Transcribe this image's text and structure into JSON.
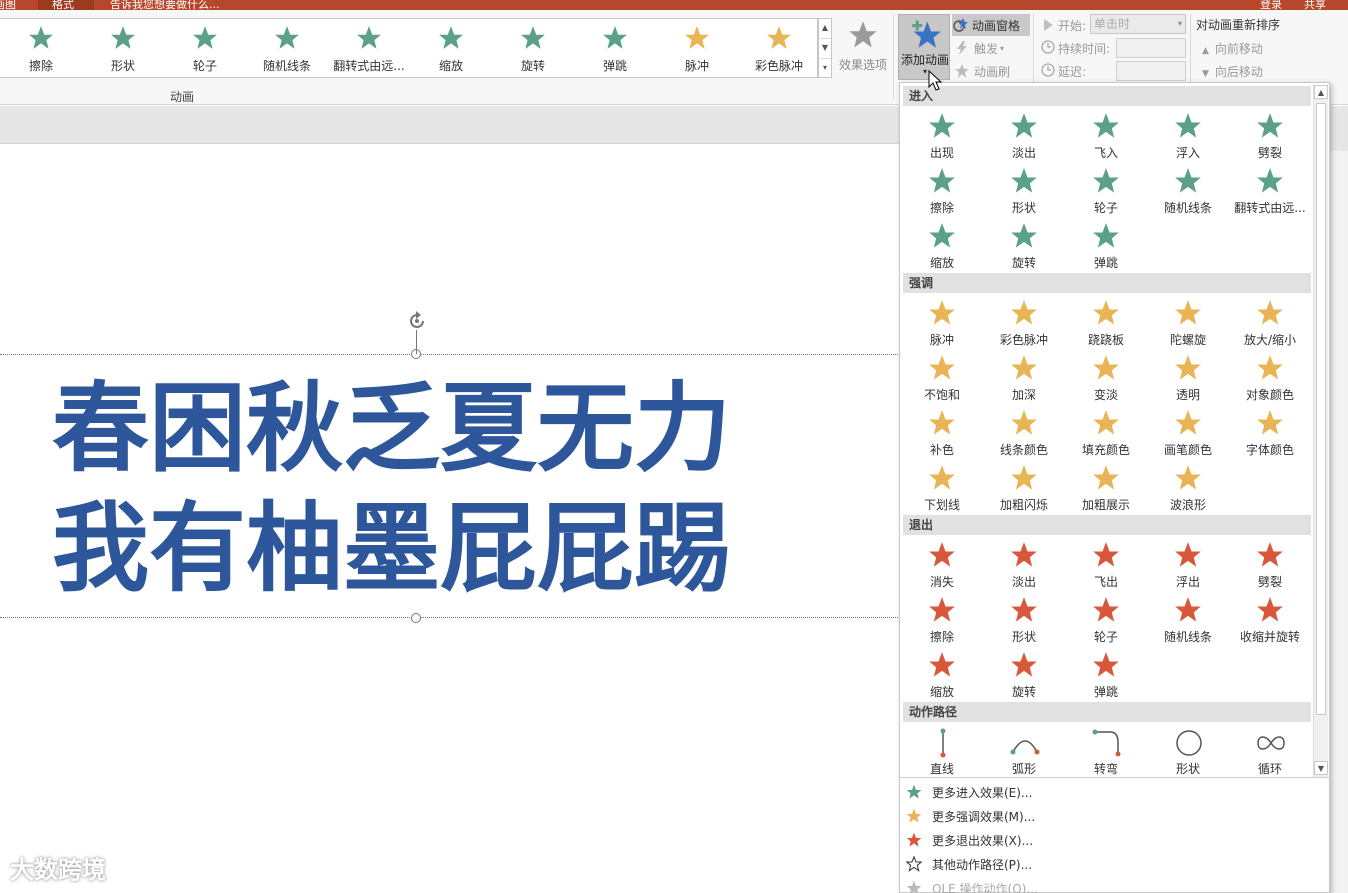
{
  "titlebar": {
    "left_tab": "画图",
    "active_tab": "格式",
    "doc_title": "告诉我您想要做什么...",
    "login": "登录",
    "share": "共享"
  },
  "ribbon": {
    "gallery": [
      {
        "label": "擦除",
        "color": "#5ba089"
      },
      {
        "label": "形状",
        "color": "#5ba089"
      },
      {
        "label": "轮子",
        "color": "#5ba089"
      },
      {
        "label": "随机线条",
        "color": "#5ba089"
      },
      {
        "label": "翻转式由远...",
        "color": "#5ba089"
      },
      {
        "label": "缩放",
        "color": "#5ba089"
      },
      {
        "label": "旋转",
        "color": "#5ba089"
      },
      {
        "label": "弹跳",
        "color": "#5ba089"
      },
      {
        "label": "脉冲",
        "color": "#e8b455"
      },
      {
        "label": "彩色脉冲",
        "color": "#e8b455"
      }
    ],
    "effect_options": "效果选项",
    "group_label": "动画",
    "add_animation": "添加动画",
    "animation_pane": "动画窗格",
    "trigger": "触发",
    "painter": "动画刷",
    "start_label": "开始:",
    "start_value": "单击时",
    "duration_label": "持续时间:",
    "delay_label": "延迟:",
    "reorder_title": "对动画重新排序",
    "move_earlier": "向前移动",
    "move_later": "向后移动"
  },
  "slide": {
    "line1": "春困秋乏夏无力",
    "line2": "我有柚墨屁屁踢",
    "text_color": "#2e579b"
  },
  "watermark": "大数跨境",
  "dropdown": {
    "entrance": {
      "title": "进入",
      "items": [
        "出现",
        "淡出",
        "飞入",
        "浮入",
        "劈裂",
        "擦除",
        "形状",
        "轮子",
        "随机线条",
        "翻转式由远...",
        "缩放",
        "旋转",
        "弹跳"
      ],
      "color": "#5ba089"
    },
    "emphasis": {
      "title": "强调",
      "items": [
        "脉冲",
        "彩色脉冲",
        "跷跷板",
        "陀螺旋",
        "放大/缩小",
        "不饱和",
        "加深",
        "变淡",
        "透明",
        "对象颜色",
        "补色",
        "线条颜色",
        "填充颜色",
        "画笔颜色",
        "字体颜色",
        "下划线",
        "加粗闪烁",
        "加粗展示",
        "波浪形"
      ],
      "color": "#e8b455"
    },
    "exit": {
      "title": "退出",
      "items": [
        "消失",
        "淡出",
        "飞出",
        "浮出",
        "劈裂",
        "擦除",
        "形状",
        "轮子",
        "随机线条",
        "收缩并旋转",
        "缩放",
        "旋转",
        "弹跳"
      ],
      "color": "#d9573a"
    },
    "paths": {
      "title": "动作路径",
      "items": [
        "直线",
        "弧形",
        "转弯",
        "形状",
        "循环"
      ]
    },
    "more": [
      {
        "label": "更多进入效果(E)...",
        "color": "#5ba089"
      },
      {
        "label": "更多强调效果(M)...",
        "color": "#e8b455"
      },
      {
        "label": "更多退出效果(X)...",
        "color": "#d9573a"
      },
      {
        "label": "其他动作路径(P)...",
        "color": "#ffffff"
      },
      {
        "label": "OLE 操作动作(O)...",
        "color": "#bbbbbb"
      }
    ]
  }
}
